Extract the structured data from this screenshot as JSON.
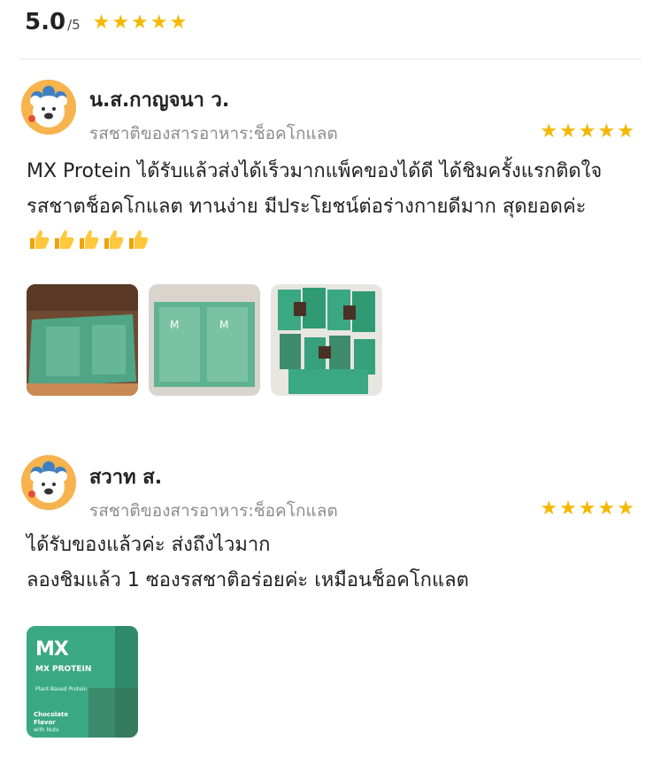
{
  "summary": {
    "score": "5.0",
    "score_max": "/5",
    "stars": 5
  },
  "reviews": [
    {
      "author": "น.ส.กาญจนา ว.",
      "variant": "รสชาติของสารอาหาร:ช็อคโกแลต",
      "stars": 5,
      "text_lines": [
        "MX Protein ได้รับแล้วส่งได้เร็วมากแพ็คของได้ดี ได้ชิมครั้งแรกติดใจ",
        "รสชาตช็อคโกแลต ทานง่าย มีประโยชน์ต่อร่างกายดีมาก สุดยอดค่ะ"
      ],
      "emoji": [
        "thumbs-up",
        "thumbs-up",
        "thumbs-up",
        "thumbs-up",
        "thumbs-up"
      ],
      "photos": [
        "box-open-photo",
        "box-packets-photo",
        "sachets-spread-photo"
      ]
    },
    {
      "author": "สวาท ส.",
      "variant": "รสชาติของสารอาหาร:ช็อคโกแลต",
      "stars": 5,
      "text_lines": [
        "ได้รับของแล้วค่ะ ส่งถึงไวมาก",
        "ลองชิมแล้ว 1 ซองรสชาติอร่อยค่ะ เหมือนช็อคโกแลต"
      ],
      "photos": [
        "mx-protein-box-photo"
      ],
      "photo_text": {
        "brand": "MX",
        "product": "MX PROTEIN",
        "subtitle": "Plant-Based Protein",
        "flavor": "Chocolate Flavor",
        "flavor_note": "with Nuts"
      }
    }
  ],
  "colors": {
    "star": "#f5b800",
    "muted": "#8c8c8c",
    "avatar_bg": "#f7b34d",
    "teal": "#3aa882"
  }
}
